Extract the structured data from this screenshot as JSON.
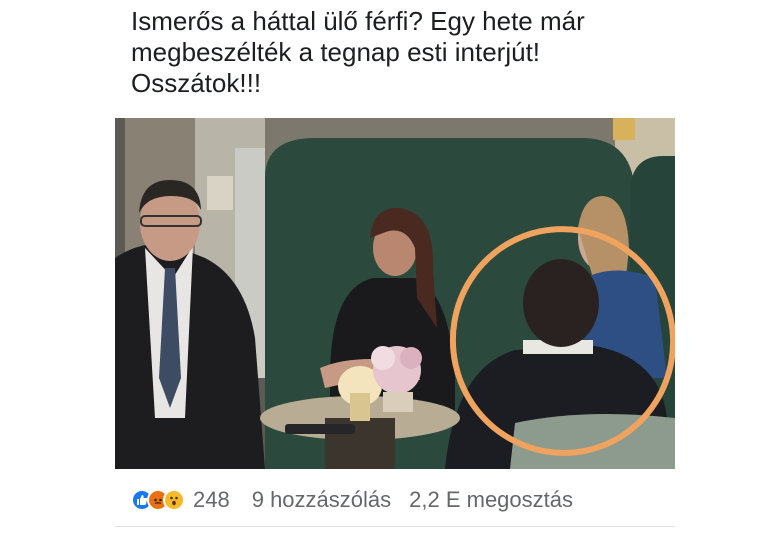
{
  "post": {
    "text": "Ismerős a háttal ülő férfi? Egy hete már\nmegbeszélték a tegnap esti interjút!\nOsszátok!!!"
  },
  "photo": {
    "icon": "photo-image",
    "highlight_color": "#f0a35e"
  },
  "reactions": {
    "icons": [
      "like-icon",
      "angry-icon",
      "wow-icon"
    ],
    "count": "248"
  },
  "comments": {
    "label": "9 hozzászólás"
  },
  "shares": {
    "label": "2,2 E megosztás"
  },
  "colors": {
    "like": "#1877f2",
    "angry": "#e9710f",
    "wow": "#f7b928"
  }
}
